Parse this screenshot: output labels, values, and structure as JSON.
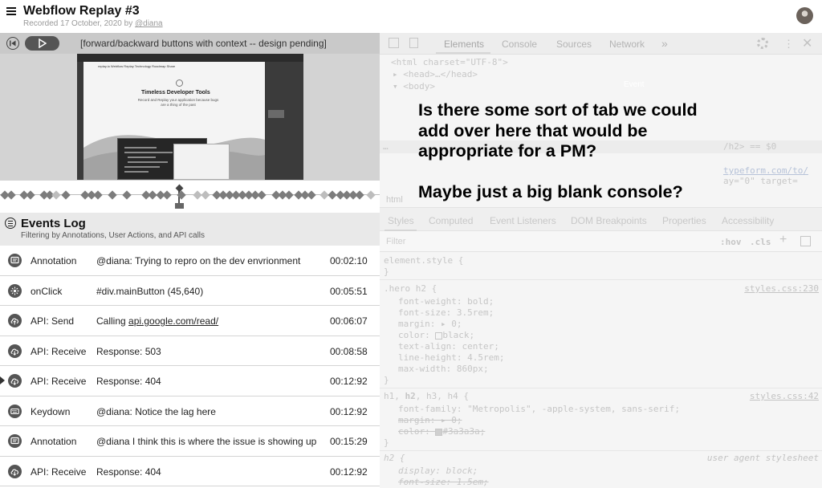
{
  "header": {
    "title": "Webflow Replay #3",
    "recorded_prefix": "Recorded 17 October, 2020 by",
    "recorded_user": "@diana"
  },
  "player": {
    "note": "[forward/backward buttons with context -- design pending]"
  },
  "preview": {
    "nav_text": "replay.io   Webflow Replay   Technology   Roadmap   Share",
    "hero_title": "Timeless Developer Tools",
    "hero_text": "Record and Replay your application because bugs are a thing of the past"
  },
  "events_log": {
    "title": "Events Log",
    "subtitle": "Filtering by Annotations, User Actions, and API calls",
    "rows": [
      {
        "type": "Annotation",
        "desc": "@diana: Trying to repro on the dev envrionment",
        "time": "00:02:10",
        "icon": "annotation-icon"
      },
      {
        "type": "onClick",
        "desc": "#div.mainButton (45,640)",
        "time": "00:05:51",
        "icon": "click-icon"
      },
      {
        "type": "API: Send",
        "desc_prefix": "Calling ",
        "desc_link": "api.google.com/read/",
        "time": "00:06:07",
        "icon": "cloud-upload-icon"
      },
      {
        "type": "API: Receive",
        "desc": "Response: 503",
        "time": "00:08:58",
        "icon": "cloud-download-icon"
      },
      {
        "type": "API: Receive",
        "desc": "Response: 404",
        "time": "00:12:92",
        "icon": "cloud-download-icon",
        "current": true
      },
      {
        "type": "Keydown",
        "desc": "@diana: Notice the lag here",
        "time": "00:12:92",
        "icon": "keyboard-icon"
      },
      {
        "type": "Annotation",
        "desc": "@diana I think this is where the issue is showing up",
        "time": "00:15:29",
        "icon": "annotation-icon"
      },
      {
        "type": "API: Receive",
        "desc": "Response: 404",
        "time": "00:12:92",
        "icon": "cloud-download-icon"
      }
    ]
  },
  "devtools": {
    "tabs": [
      "Elements",
      "Console",
      "Sources",
      "Network"
    ],
    "more_tabs": "»",
    "hint": "Event",
    "elements": {
      "line1": "<html charset=\"UTF-8\">",
      "line2": "<head>…</head>",
      "line3": "<body>",
      "ellipsis": "…",
      "selected_tail": "/h2> == $0",
      "link_text": "typeform.com/to/",
      "attr_line": "ay=\"0\" target=",
      "crumb": "html"
    },
    "subtabs": [
      "Styles",
      "Computed",
      "Event Listeners",
      "DOM Breakpoints",
      "Properties",
      "Accessibility"
    ],
    "filter_placeholder": "Filter",
    "hov": ":hov",
    "cls": ".cls",
    "plus": "+",
    "styles": {
      "element_style": "element.style {",
      "close": "}",
      "rule1_selector": ".hero h2 {",
      "rule1_src": "styles.css:230",
      "rule1_props": [
        "font-weight: bold;",
        "font-size: 3.5rem;",
        "margin: ▸ 0;",
        "color:",
        "text-align: center;",
        "line-height: 4.5rem;",
        "max-width: 860px;"
      ],
      "rule1_color_value": "black;",
      "rule2_selector_pre": "h1, ",
      "rule2_selector_bold": "h2",
      "rule2_selector_post": ", h3, h4 {",
      "rule2_src": "styles.css:42",
      "rule2_props": [
        "font-family: \"Metropolis\", -apple-system, sans-serif;",
        "margin: ▸ 0;",
        "color:"
      ],
      "rule2_color_value": "#3a3a3a;",
      "rule3_selector": "h2 {",
      "rule3_src": "user agent stylesheet",
      "rule3_props": [
        "display: block;",
        "font-size: 1.5em;"
      ]
    }
  },
  "overlay_note": {
    "line1": "Is there some sort of tab we could add over here that would be appropriate for a PM?",
    "line2": "Maybe just a big blank console?"
  }
}
